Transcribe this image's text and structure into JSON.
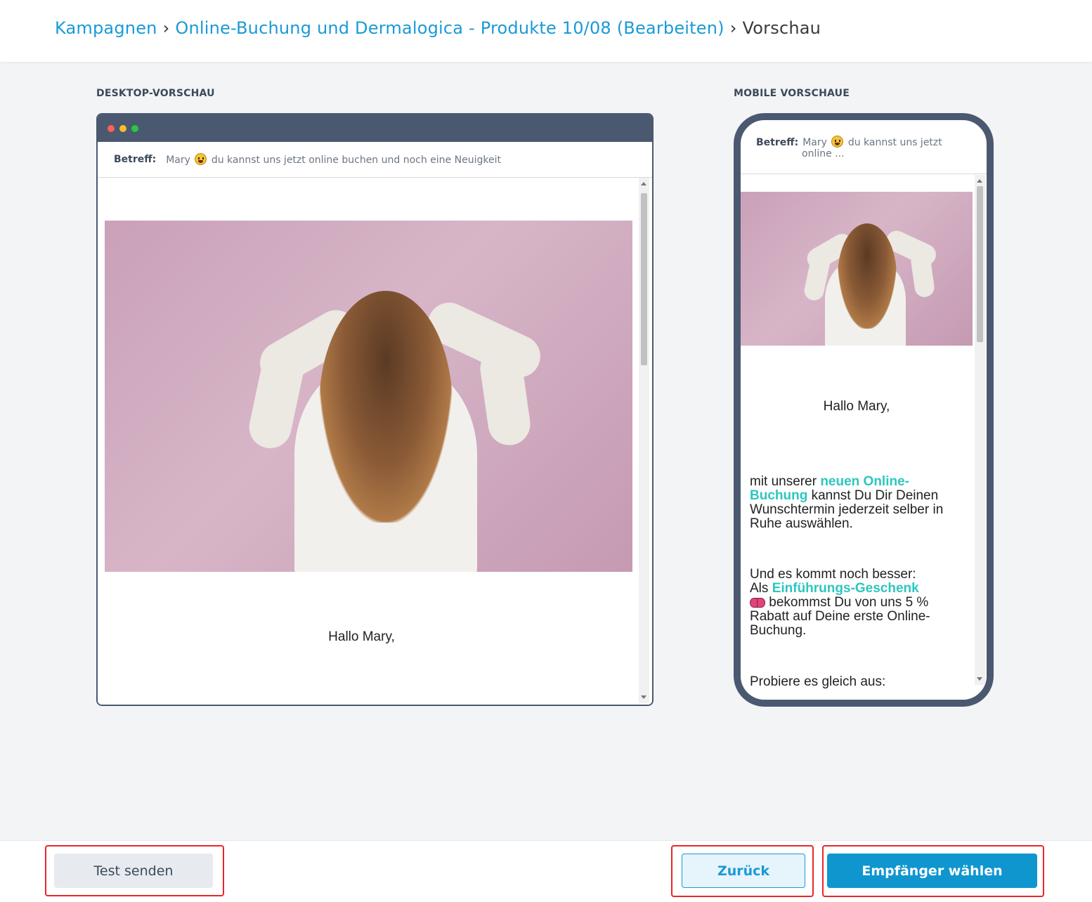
{
  "breadcrumb": {
    "items": [
      "Kampagnen",
      "Online-Buchung und Dermalogica - Produkte 10/08 (Bearbeiten)"
    ],
    "separator": "›",
    "current": "Vorschau"
  },
  "desktop_preview": {
    "label": "DESKTOP-VORSCHAU",
    "subject_label": "Betreff:",
    "subject_name": "Mary",
    "subject_rest": "du kannst uns jetzt online buchen und noch eine Neuigkeit",
    "greeting": "Hallo Mary,"
  },
  "mobile_preview": {
    "label": "MOBILE VORSCHAUE",
    "subject_label": "Betreff:",
    "subject_name": "Mary",
    "subject_rest_line1": "du kannst uns jetzt",
    "subject_rest_line2": "online ...",
    "greeting": "Hallo Mary,",
    "para1_pre": "mit unserer ",
    "para1_highlight": "neuen Online-Buchung",
    "para1_post": " kannst Du Dir Deinen Wunschtermin jederzeit selber in Ruhe auswählen.",
    "para2_line1": "Und es kommt noch besser:",
    "para2_pre": "Als ",
    "para2_highlight": "Einführungs-Geschenk",
    "para2_post": " bekommst Du von uns 5 % Rabatt auf Deine erste Online-Buchung.",
    "para3": "Probiere es gleich aus:"
  },
  "footer": {
    "test_button": "Test senden",
    "back_button": "Zurück",
    "next_button": "Empfänger wählen"
  },
  "colors": {
    "link": "#1a9ad6",
    "primary_button": "#0f96cf",
    "frame_dark": "#4a5970",
    "highlight_text": "#2ec6c0",
    "annotation_outline": "#e8262b"
  }
}
